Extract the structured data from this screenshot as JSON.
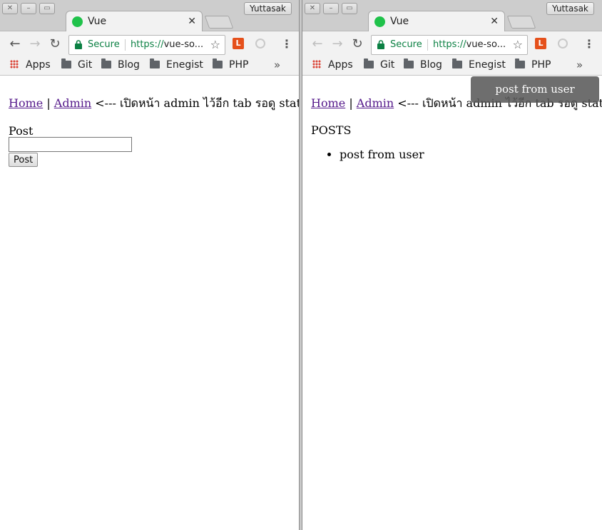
{
  "left_window": {
    "user": "Yuttasak",
    "tab_title": "Vue",
    "omnibox": {
      "secure_label": "Secure",
      "url_scheme": "https://",
      "url_rest": "vue-so..."
    },
    "bookmarks": [
      {
        "label": "Apps"
      },
      {
        "label": "Git"
      },
      {
        "label": "Blog"
      },
      {
        "label": "Enegist"
      },
      {
        "label": "PHP"
      }
    ],
    "bookmarks_more": "»",
    "page": {
      "nav": {
        "home": "Home",
        "sep": " | ",
        "admin": "Admin",
        "note": " <--- เปิดหน้า admin ไว้อีก tab รอดู state"
      },
      "post_label": "Post",
      "post_value": "",
      "post_button": "Post"
    }
  },
  "right_window": {
    "user": "Yuttasak",
    "tab_title": "Vue",
    "omnibox": {
      "secure_label": "Secure",
      "url_scheme": "https://",
      "url_rest": "vue-so..."
    },
    "bookmarks": [
      {
        "label": "Apps"
      },
      {
        "label": "Git"
      },
      {
        "label": "Blog"
      },
      {
        "label": "Enegist"
      },
      {
        "label": "PHP"
      }
    ],
    "bookmarks_more": "»",
    "page": {
      "nav": {
        "home": "Home",
        "sep": " | ",
        "admin": "Admin",
        "note": " <--- เปิดหน้า admin ไว้อีก tab รอดู state"
      },
      "posts_heading": "POSTS",
      "posts": [
        "post from user"
      ],
      "toast": "post from user"
    }
  },
  "colors": {
    "secure_green": "#0b8043",
    "link_visited": "#551a8b",
    "favicon": "#1fc24a"
  }
}
